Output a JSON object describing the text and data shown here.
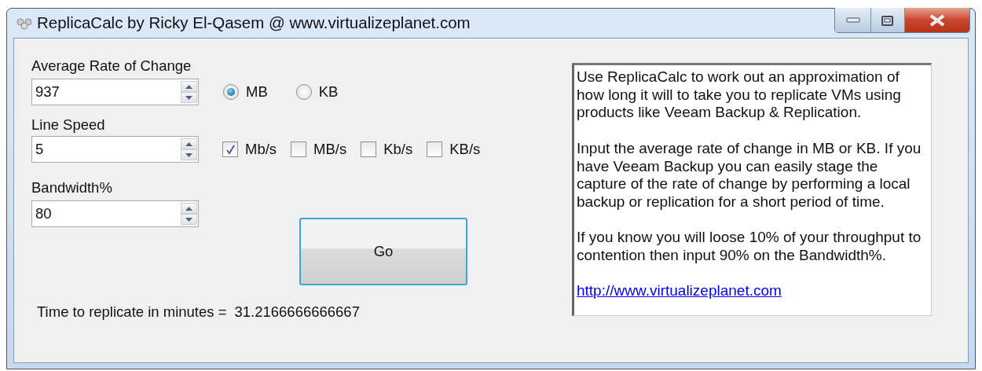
{
  "window": {
    "title": "ReplicaCalc by Ricky El-Qasem @ www.virtualizeplanet.com",
    "buttons": [
      {
        "kind": "minimize"
      },
      {
        "kind": "maximize"
      },
      {
        "kind": "close"
      }
    ]
  },
  "fields": [
    {
      "label": "Average Rate of Change",
      "value": "937",
      "options": [
        {
          "kind": "radio",
          "label": "MB",
          "selected": true
        },
        {
          "kind": "radio",
          "label": "KB",
          "selected": false
        }
      ]
    },
    {
      "label": "Line Speed",
      "value": "5",
      "options": [
        {
          "kind": "checkbox",
          "label": "Mb/s",
          "checked": true
        },
        {
          "kind": "checkbox",
          "label": "MB/s",
          "checked": false
        },
        {
          "kind": "checkbox",
          "label": "Kb/s",
          "checked": false
        },
        {
          "kind": "checkbox",
          "label": "KB/s",
          "checked": false
        }
      ]
    },
    {
      "label": "Bandwidth%",
      "value": "80"
    }
  ],
  "go_button": "Go",
  "result": {
    "label": "Time to replicate in minutes =",
    "value": "31.2166666666667"
  },
  "info": {
    "paragraphs": [
      "Use ReplicaCalc to work out an approximation of how long it will to take you to replicate VMs using products like Veeam Backup & Replication.",
      "Input the average rate of change in MB or KB. If you have Veeam Backup you can easily stage the capture of the rate of change by performing a local backup or replication for a short period of time.",
      "If you know you will loose 10% of your throughput to contention then input 90% on the Bandwidth%."
    ],
    "link": "http://www.virtualizeplanet.com"
  }
}
